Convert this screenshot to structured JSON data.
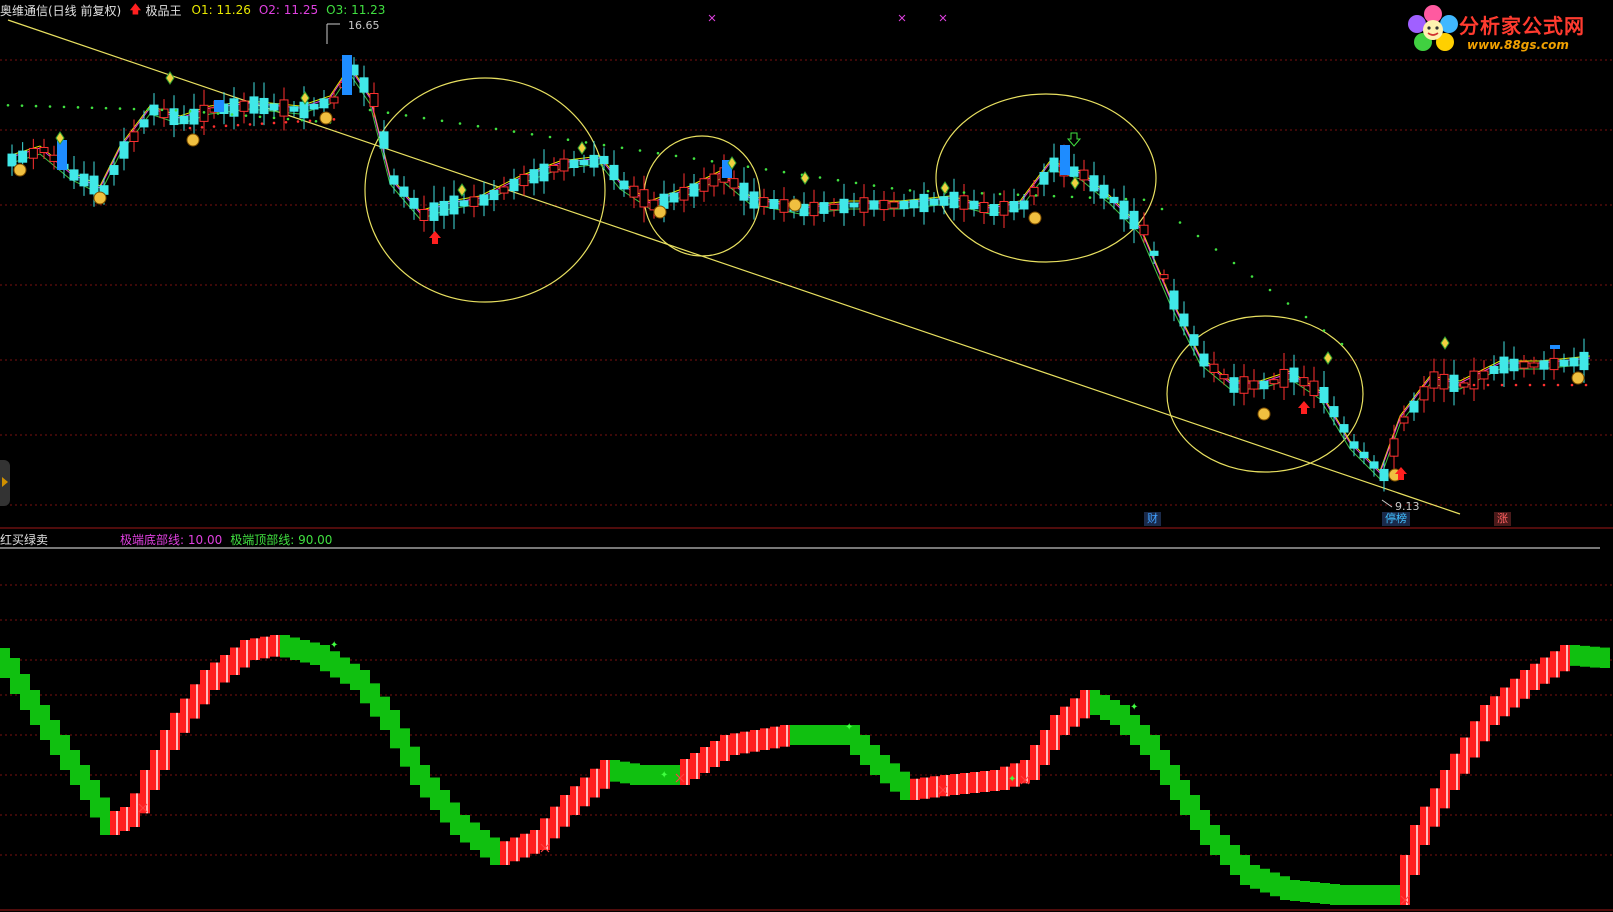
{
  "header": {
    "stock_name": "奥维通信(日线 前复权)",
    "indicator_name": "极品王",
    "o1_label": "O1: 11.26",
    "o2_label": "O2: 11.25",
    "o3_label": "O3: 11.23",
    "colors": {
      "o1": "#e8e800",
      "o2": "#e040e0",
      "o3": "#40e040"
    }
  },
  "logo": {
    "title": "分析家公式网",
    "url": "www.88gs.com"
  },
  "main_chart": {
    "high_label": "16.65",
    "low_label": "9.13",
    "event_tags": [
      {
        "text": "财",
        "color": "#40a0ff"
      },
      {
        "text": "停榜",
        "color": "#40c0ff"
      },
      {
        "text": "涨",
        "color": "#ff6060"
      }
    ]
  },
  "sub_chart": {
    "title": "红买绿卖",
    "bottom_line_label": "极端底部线: 10.00",
    "top_line_label": "极端顶部线: 90.00",
    "colors": {
      "bottom_line": "#e040e0",
      "top_line": "#40e040",
      "buy": "#ff2020",
      "sell": "#10c010"
    }
  },
  "chart_data": {
    "type": "candlestick",
    "series": [
      {
        "name": "O1"
      },
      {
        "name": "O2"
      },
      {
        "name": "O3"
      }
    ],
    "price_extremes": {
      "high": 16.65,
      "low": 9.13
    },
    "oscillator": {
      "type": "bar",
      "levels": {
        "bottom": 10.0,
        "top": 90.0
      }
    }
  }
}
